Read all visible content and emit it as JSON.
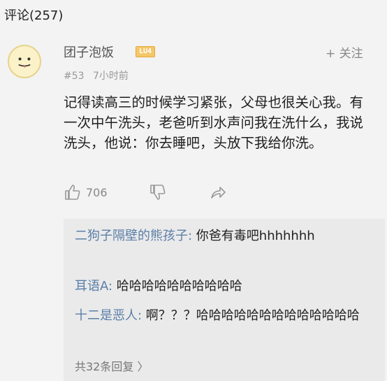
{
  "header": {
    "title": "评论(257)"
  },
  "comment": {
    "username": "团子泡饭",
    "level_badge": "LU4",
    "follow_label": "+ 关注",
    "floor": "#53",
    "time": "7小时前",
    "content": "记得读高三的时候学习紧张，父母也很关心我。有一次中午洗头，老爸听到水声问我在洗什么，我说洗头，他说：你去睡吧，头放下我给你洗。",
    "likes": "706",
    "icons": [
      "thumbs-up-icon",
      "thumbs-down-icon",
      "share-icon"
    ]
  },
  "replies": [
    {
      "author": "二狗子隔壁的熊孩子:",
      "text": " 你爸有毒吧hhhhhhh"
    },
    {
      "author": "耳语A:",
      "text": " 哈哈哈哈哈哈哈哈哈哈"
    },
    {
      "author": "十二是恶人:",
      "text": " 啊？？？哈哈哈哈哈哈哈哈哈哈哈哈哈"
    }
  ],
  "total_replies": "共32条回复 〉",
  "colors": {
    "author": "#5b7fa8",
    "badge": "#f5c76a",
    "background": "#f3f3f3",
    "reply_background": "#eaeaea"
  }
}
